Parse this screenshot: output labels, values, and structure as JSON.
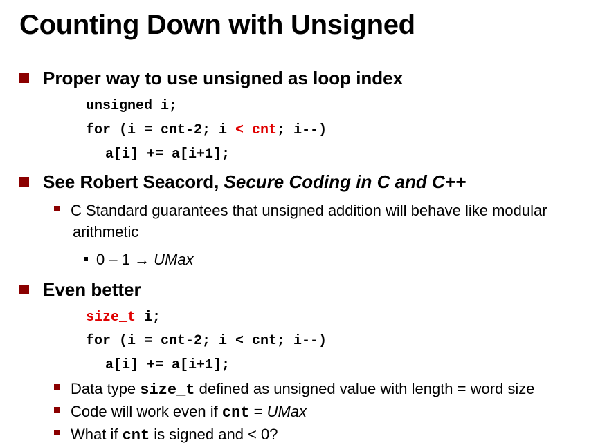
{
  "title": "Counting Down with Unsigned",
  "section1": {
    "heading": "Proper way to use unsigned as loop index",
    "code": {
      "line1": "unsigned i;",
      "line2_pre": "for (i = cnt-2; i ",
      "line2_hl": "< cnt",
      "line2_post": "; i--)",
      "line3": "a[i] += a[i+1];"
    }
  },
  "section2": {
    "heading_pre": "See Robert Seacord, ",
    "heading_book": "Secure Coding in C and C++",
    "bullet_line1": "C Standard guarantees that unsigned addition will behave like modular",
    "bullet_line2": "arithmetic",
    "sub_pre": "0 – 1 → ",
    "sub_umax": "UMax"
  },
  "section3": {
    "heading": "Even better",
    "code": {
      "line1_hl": "size_t",
      "line1_post": " i;",
      "line2": "for (i = cnt-2; i < cnt; i--)",
      "line3": "a[i] += a[i+1];"
    },
    "bullets": {
      "b1_pre": "Data type ",
      "b1_code": "size_t",
      "b1_post": " defined as unsigned value with length = word size",
      "b2_pre": "Code will work even if ",
      "b2_code": "cnt",
      "b2_mid": " = ",
      "b2_umax": "UMax",
      "b3_pre": "What if ",
      "b3_code": "cnt",
      "b3_post": " is signed and < 0?"
    }
  }
}
